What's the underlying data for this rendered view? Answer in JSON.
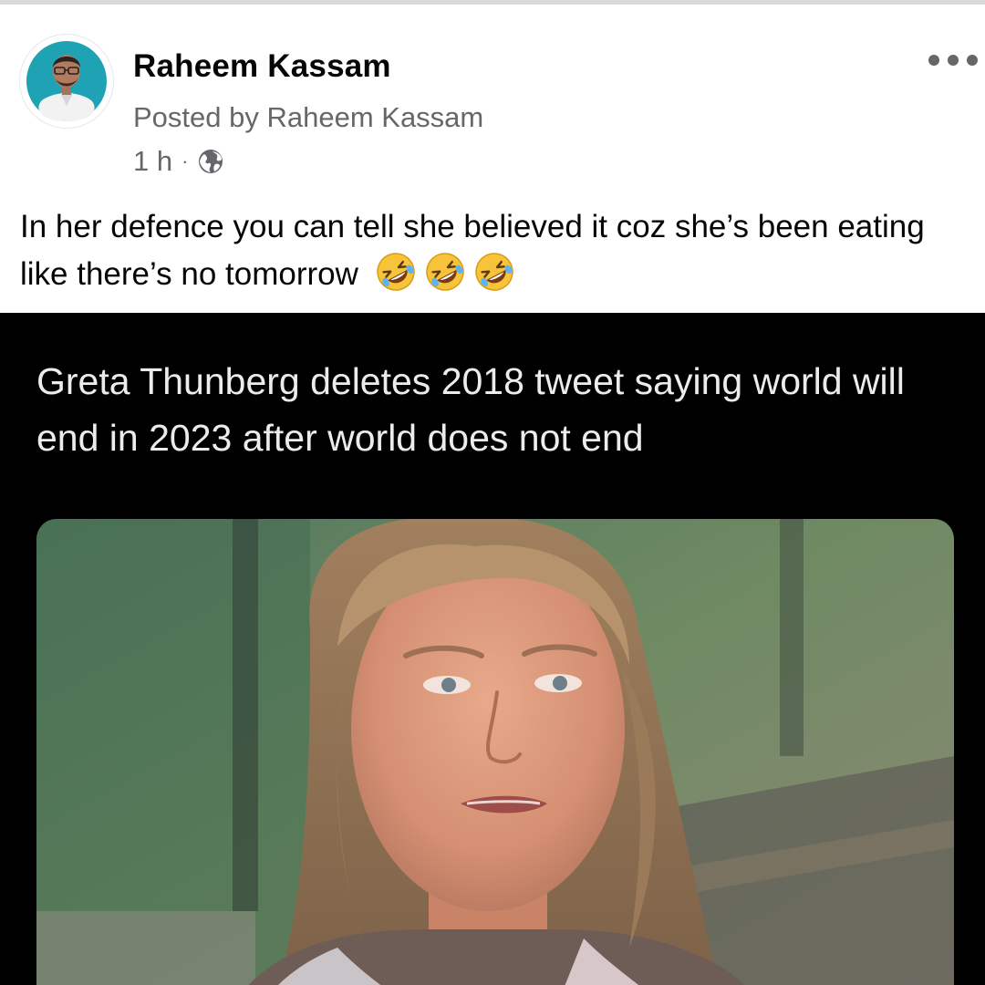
{
  "post": {
    "author": "Raheem Kassam",
    "posted_by": "Posted by Raheem Kassam",
    "time": "1 h",
    "separator": "·",
    "audience_icon": "globe-icon",
    "caption": "In her defence you can tell she believed it coz she’s been eating like there’s no tomorrow",
    "reaction_emoji": [
      "rolling-on-floor-laughing-emoji",
      "rolling-on-floor-laughing-emoji",
      "rolling-on-floor-laughing-emoji"
    ]
  },
  "media": {
    "headline": "Greta Thunberg deletes 2018 tweet saying world will end in 2023 after world does not end",
    "background": "#000000"
  },
  "colors": {
    "name": "#050505",
    "secondary": "#65676b",
    "avatar_bg": "#1fa3b4"
  },
  "menu": {
    "icon": "more-options-icon"
  }
}
